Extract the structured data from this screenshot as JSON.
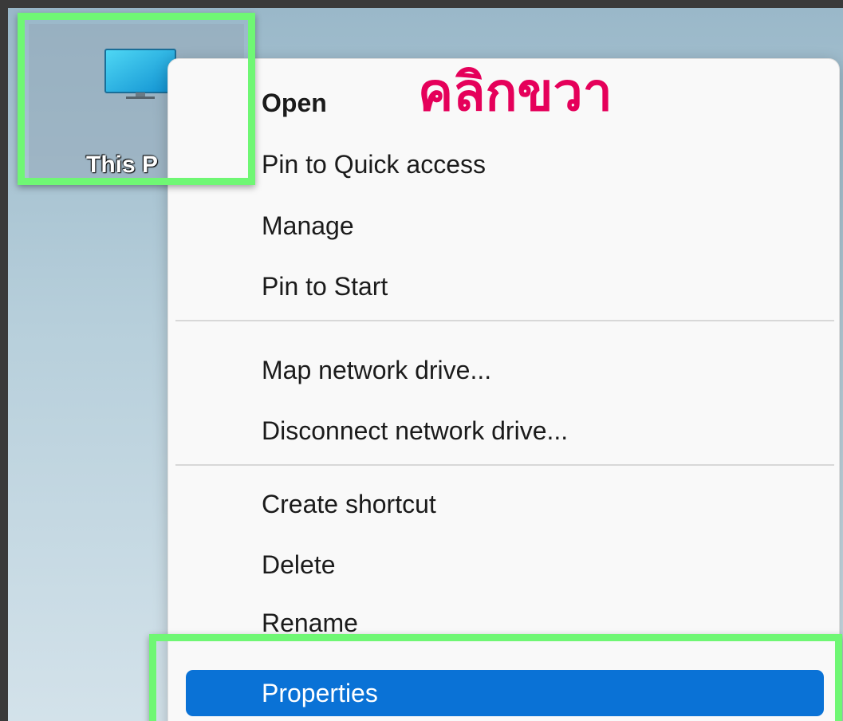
{
  "desktop": {
    "this_pc_icon": {
      "icon": "monitor-icon",
      "label": "This P"
    }
  },
  "annotation": {
    "caption": "คลิกขวา",
    "highlight_color": "#6ff774",
    "caption_color": "#e5005a"
  },
  "context_menu": {
    "group1": [
      {
        "label": "Open",
        "bold": true
      },
      {
        "label": "Pin to Quick access"
      },
      {
        "label": "Manage"
      },
      {
        "label": "Pin to Start"
      }
    ],
    "group2": [
      {
        "label": "Map network drive..."
      },
      {
        "label": "Disconnect network drive..."
      }
    ],
    "group3": [
      {
        "label": "Create shortcut"
      },
      {
        "label": "Delete"
      },
      {
        "label": "Rename"
      },
      {
        "label": "Properties",
        "selected": true
      }
    ],
    "selected_color": "#0a72d6"
  }
}
